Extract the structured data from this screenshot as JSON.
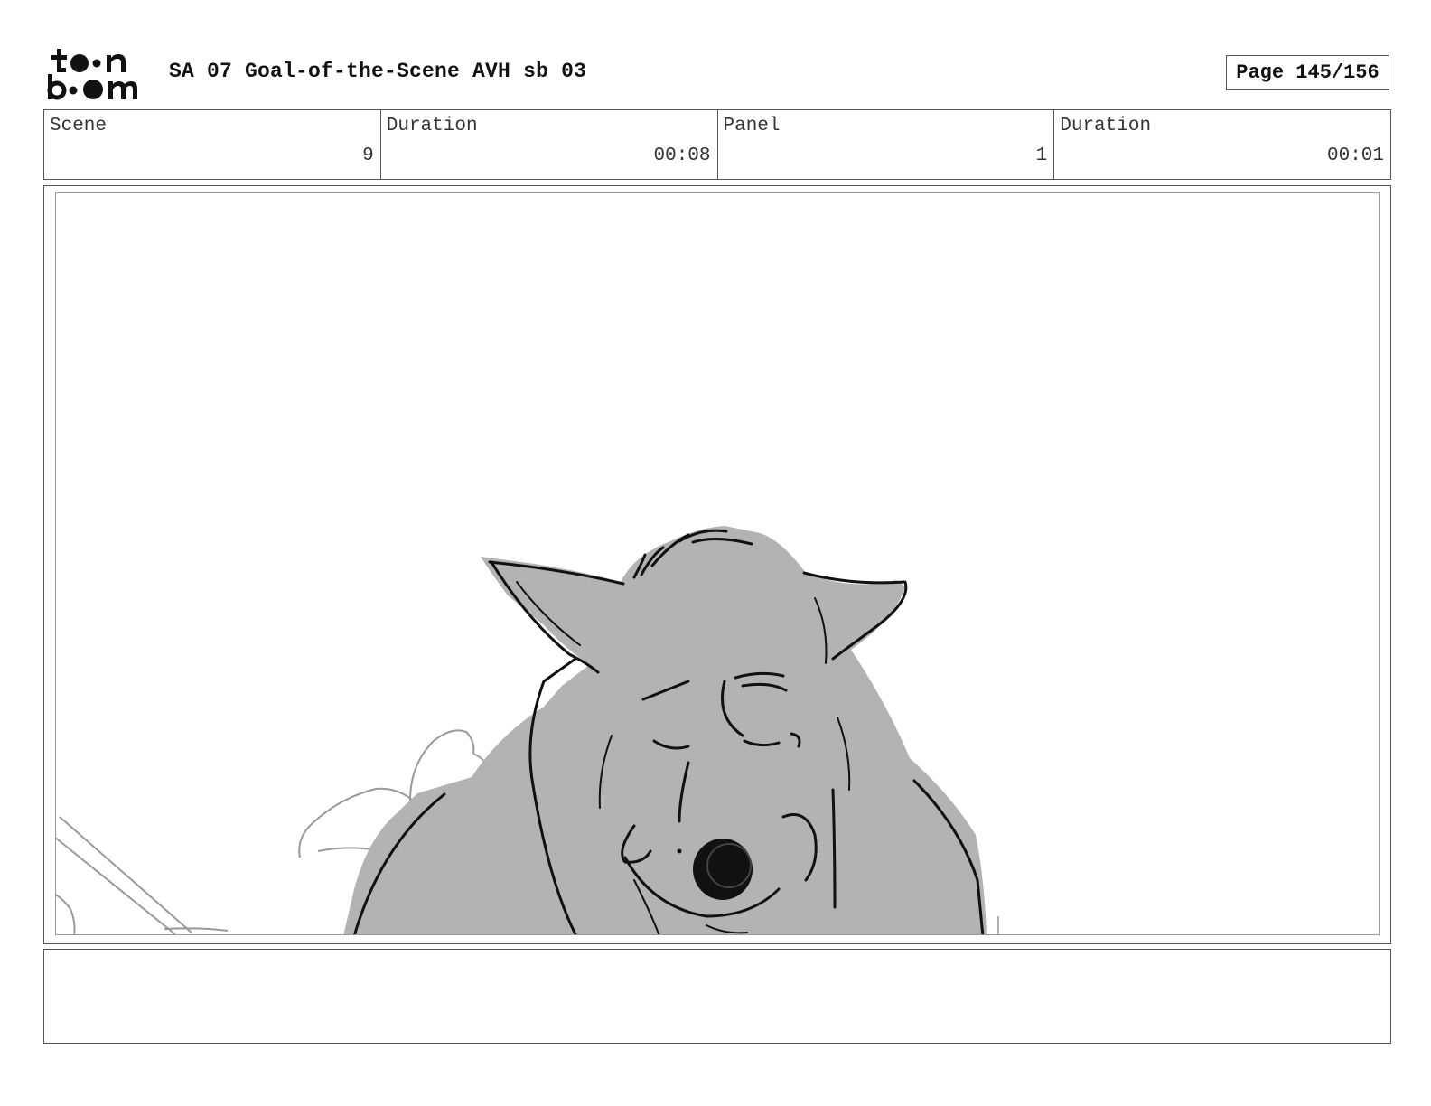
{
  "header": {
    "logo": {
      "line1": "toon",
      "line2": "boom"
    },
    "title": "SA 07 Goal-of-the-Scene AVH sb 03",
    "page_counter": "Page 145/156"
  },
  "info": {
    "scene_label": "Scene",
    "scene_value": "9",
    "scene_duration_label": "Duration",
    "scene_duration_value": "00:08",
    "panel_label": "Panel",
    "panel_value": "1",
    "panel_duration_label": "Duration",
    "panel_duration_value": "00:01"
  },
  "panel": {
    "drawing": "wolf-sketch-icon",
    "colors": {
      "fill": "#b3b3b3",
      "line": "#111111",
      "sketch": "#999999"
    }
  },
  "notes": {
    "text": ""
  }
}
